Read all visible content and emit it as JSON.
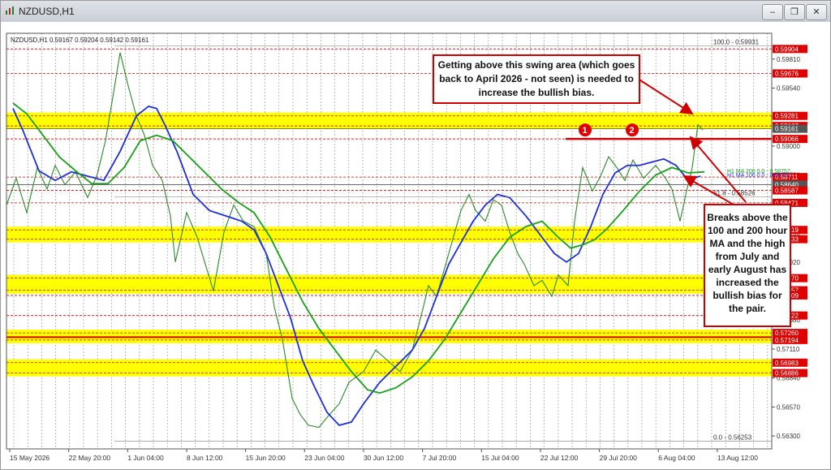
{
  "window": {
    "title": "NZDUSD,H1"
  },
  "chart_data": {
    "type": "line",
    "title": "",
    "info_label": "NZDUSD,H1  0.59167 0.59204 0.59142 0.59161",
    "ylim": [
      0.5618,
      0.6005
    ],
    "x_ticks": [
      "15 May 2026",
      "22 May 20:00",
      "1 Jun 04:00",
      "8 Jun 12:00",
      "15 Jun 20:00",
      "23 Jun 04:00",
      "30 Jun 12:00",
      "7 Jul 20:00",
      "15 Jul 04:00",
      "22 Jul 12:00",
      "29 Jul 20:00",
      "6 Aug 04:00",
      "13 Aug 12:00"
    ],
    "y_ticks": [
      "0.59810",
      "0.59540",
      "0.59270",
      "0.59000",
      "0.58730",
      "0.58460",
      "0.58190",
      "0.57920",
      "0.57650",
      "0.57380",
      "0.57110",
      "0.56840",
      "0.56570",
      "0.56300"
    ],
    "price_labels": [
      {
        "text": "0.59904",
        "value": 0.59904,
        "color": "#e00000"
      },
      {
        "text": "0.59676",
        "value": 0.59676,
        "color": "#e00000"
      },
      {
        "text": "0.59281",
        "value": 0.59281,
        "color": "#e00000"
      },
      {
        "text": "0.59187",
        "value": 0.59187,
        "color": "#e00000"
      },
      {
        "text": "0.59161",
        "value": 0.59161,
        "color": "#555555"
      },
      {
        "text": "0.59066",
        "value": 0.59066,
        "color": "#e00000"
      },
      {
        "text": "0.58711",
        "value": 0.58711,
        "color": "#e00000"
      },
      {
        "text": "0.58640",
        "value": 0.5864,
        "color": "#555555"
      },
      {
        "text": "0.58587",
        "value": 0.58587,
        "color": "#e00000"
      },
      {
        "text": "0.58471",
        "value": 0.58471,
        "color": "#e00000"
      },
      {
        "text": "0.58219",
        "value": 0.58219,
        "color": "#e00000"
      },
      {
        "text": "0.58133",
        "value": 0.58133,
        "color": "#e00000"
      },
      {
        "text": "0.57770",
        "value": 0.5777,
        "color": "#e00000"
      },
      {
        "text": "0.57657",
        "value": 0.57657,
        "color": "#e00000"
      },
      {
        "text": "0.57609",
        "value": 0.57609,
        "color": "#e00000"
      },
      {
        "text": "0.57422",
        "value": 0.57422,
        "color": "#e00000"
      },
      {
        "text": "0.57260",
        "value": 0.5726,
        "color": "#e00000"
      },
      {
        "text": "0.57194",
        "value": 0.57194,
        "color": "#e00000"
      },
      {
        "text": "0.56983",
        "value": 0.56983,
        "color": "#e00000"
      },
      {
        "text": "0.56886",
        "value": 0.56886,
        "color": "#e00000"
      }
    ],
    "bands": [
      {
        "y1": 0.59187,
        "y2": 0.59281
      },
      {
        "y1": 0.58133,
        "y2": 0.58219
      },
      {
        "y1": 0.57657,
        "y2": 0.5777
      },
      {
        "y1": 0.57194,
        "y2": 0.5726
      },
      {
        "y1": 0.56886,
        "y2": 0.56983
      }
    ],
    "fib_labels": [
      {
        "text": "100.0 - 0.59931",
        "value": 0.59931
      },
      {
        "text": "61.8 - 0.58526",
        "value": 0.58526
      },
      {
        "text": "0.0 - 0.56253",
        "value": 0.56253
      }
    ],
    "ma_labels": [
      {
        "text": "H1 MA 200 0.0 - 0.58757",
        "value": 0.58757
      },
      {
        "text": "H1 MA 100 0.0 - 0.58721",
        "value": 0.58721
      }
    ],
    "markers": [
      "1",
      "2"
    ],
    "series": [
      {
        "name": "price",
        "color": "#2a8a2a",
        "points": [
          [
            0,
            0.5845
          ],
          [
            12,
            0.587
          ],
          [
            25,
            0.5838
          ],
          [
            38,
            0.588
          ],
          [
            50,
            0.586
          ],
          [
            60,
            0.5882
          ],
          [
            72,
            0.5864
          ],
          [
            85,
            0.5876
          ],
          [
            100,
            0.5852
          ],
          [
            112,
            0.5874
          ],
          [
            122,
            0.5905
          ],
          [
            132,
            0.595
          ],
          [
            140,
            0.5987
          ],
          [
            150,
            0.5956
          ],
          [
            160,
            0.5928
          ],
          [
            170,
            0.591
          ],
          [
            180,
            0.5882
          ],
          [
            192,
            0.5868
          ],
          [
            202,
            0.5835
          ],
          [
            208,
            0.5792
          ],
          [
            222,
            0.5838
          ],
          [
            235,
            0.5815
          ],
          [
            255,
            0.5765
          ],
          [
            268,
            0.582
          ],
          [
            280,
            0.5845
          ],
          [
            292,
            0.583
          ],
          [
            305,
            0.5825
          ],
          [
            320,
            0.58
          ],
          [
            330,
            0.575
          ],
          [
            340,
            0.572
          ],
          [
            352,
            0.5665
          ],
          [
            362,
            0.565
          ],
          [
            372,
            0.564
          ],
          [
            385,
            0.5638
          ],
          [
            398,
            0.565
          ],
          [
            410,
            0.566
          ],
          [
            422,
            0.568
          ],
          [
            440,
            0.569
          ],
          [
            455,
            0.571
          ],
          [
            470,
            0.57
          ],
          [
            485,
            0.569
          ],
          [
            500,
            0.571
          ],
          [
            512,
            0.5745
          ],
          [
            520,
            0.577
          ],
          [
            530,
            0.576
          ],
          [
            545,
            0.58
          ],
          [
            560,
            0.584
          ],
          [
            570,
            0.5855
          ],
          [
            578,
            0.584
          ],
          [
            590,
            0.583
          ],
          [
            600,
            0.585
          ],
          [
            610,
            0.5845
          ],
          [
            620,
            0.582
          ],
          [
            630,
            0.58
          ],
          [
            638,
            0.579
          ],
          [
            650,
            0.577
          ],
          [
            660,
            0.5775
          ],
          [
            672,
            0.576
          ],
          [
            680,
            0.578
          ],
          [
            692,
            0.577
          ],
          [
            700,
            0.583
          ],
          [
            710,
            0.588
          ],
          [
            722,
            0.5858
          ],
          [
            732,
            0.5872
          ],
          [
            742,
            0.589
          ],
          [
            752,
            0.588
          ],
          [
            762,
            0.5868
          ],
          [
            772,
            0.5887
          ],
          [
            785,
            0.587
          ],
          [
            800,
            0.5882
          ],
          [
            812,
            0.587
          ],
          [
            820,
            0.586
          ],
          [
            830,
            0.583
          ],
          [
            838,
            0.5858
          ],
          [
            845,
            0.588
          ],
          [
            852,
            0.592
          ],
          [
            858,
            0.5915
          ]
        ]
      },
      {
        "name": "100 hour MA",
        "color": "#1c2fe0",
        "points": [
          [
            8,
            0.5935
          ],
          [
            20,
            0.5915
          ],
          [
            40,
            0.5877
          ],
          [
            60,
            0.5868
          ],
          [
            80,
            0.5876
          ],
          [
            100,
            0.5872
          ],
          [
            120,
            0.5868
          ],
          [
            140,
            0.5895
          ],
          [
            160,
            0.5928
          ],
          [
            175,
            0.5937
          ],
          [
            185,
            0.5935
          ],
          [
            195,
            0.592
          ],
          [
            210,
            0.5895
          ],
          [
            230,
            0.5855
          ],
          [
            250,
            0.584
          ],
          [
            270,
            0.5835
          ],
          [
            290,
            0.583
          ],
          [
            305,
            0.5822
          ],
          [
            320,
            0.58
          ],
          [
            335,
            0.577
          ],
          [
            350,
            0.574
          ],
          [
            365,
            0.57
          ],
          [
            380,
            0.5675
          ],
          [
            395,
            0.5652
          ],
          [
            410,
            0.564
          ],
          [
            425,
            0.5643
          ],
          [
            440,
            0.566
          ],
          [
            460,
            0.568
          ],
          [
            480,
            0.5695
          ],
          [
            500,
            0.571
          ],
          [
            515,
            0.573
          ],
          [
            530,
            0.576
          ],
          [
            545,
            0.579
          ],
          [
            560,
            0.581
          ],
          [
            575,
            0.583
          ],
          [
            590,
            0.5845
          ],
          [
            605,
            0.5855
          ],
          [
            620,
            0.5852
          ],
          [
            640,
            0.5835
          ],
          [
            660,
            0.5815
          ],
          [
            675,
            0.58
          ],
          [
            690,
            0.5792
          ],
          [
            705,
            0.58
          ],
          [
            720,
            0.5825
          ],
          [
            735,
            0.5855
          ],
          [
            750,
            0.5875
          ],
          [
            765,
            0.5882
          ],
          [
            780,
            0.5882
          ],
          [
            795,
            0.5885
          ],
          [
            810,
            0.5888
          ],
          [
            825,
            0.5882
          ],
          [
            840,
            0.5868
          ],
          [
            855,
            0.5872
          ]
        ]
      },
      {
        "name": "200 hour MA",
        "color": "#16a016",
        "points": [
          [
            8,
            0.594
          ],
          [
            25,
            0.593
          ],
          [
            45,
            0.591
          ],
          [
            65,
            0.589
          ],
          [
            85,
            0.5877
          ],
          [
            105,
            0.5865
          ],
          [
            125,
            0.5865
          ],
          [
            145,
            0.588
          ],
          [
            165,
            0.5905
          ],
          [
            185,
            0.591
          ],
          [
            205,
            0.5905
          ],
          [
            225,
            0.589
          ],
          [
            245,
            0.5875
          ],
          [
            265,
            0.586
          ],
          [
            285,
            0.5848
          ],
          [
            305,
            0.5838
          ],
          [
            325,
            0.5815
          ],
          [
            345,
            0.5785
          ],
          [
            365,
            0.5755
          ],
          [
            385,
            0.573
          ],
          [
            405,
            0.571
          ],
          [
            425,
            0.569
          ],
          [
            445,
            0.5673
          ],
          [
            460,
            0.567
          ],
          [
            480,
            0.5675
          ],
          [
            500,
            0.5685
          ],
          [
            520,
            0.57
          ],
          [
            540,
            0.572
          ],
          [
            560,
            0.5745
          ],
          [
            580,
            0.577
          ],
          [
            600,
            0.5795
          ],
          [
            620,
            0.5815
          ],
          [
            640,
            0.5825
          ],
          [
            660,
            0.583
          ],
          [
            680,
            0.5815
          ],
          [
            695,
            0.5805
          ],
          [
            710,
            0.5808
          ],
          [
            725,
            0.5813
          ],
          [
            740,
            0.5823
          ],
          [
            760,
            0.584
          ],
          [
            780,
            0.5858
          ],
          [
            800,
            0.5873
          ],
          [
            820,
            0.588
          ],
          [
            840,
            0.5875
          ],
          [
            860,
            0.5876
          ]
        ]
      }
    ]
  },
  "annotations": {
    "top": "Getting above this swing area (which goes back to April 2026 - not seen) is needed to increase the bullish bias.",
    "right": "Breaks above the 100 and 200 hour MA and the high from July and early August has increased the bullish bias for the pair."
  }
}
